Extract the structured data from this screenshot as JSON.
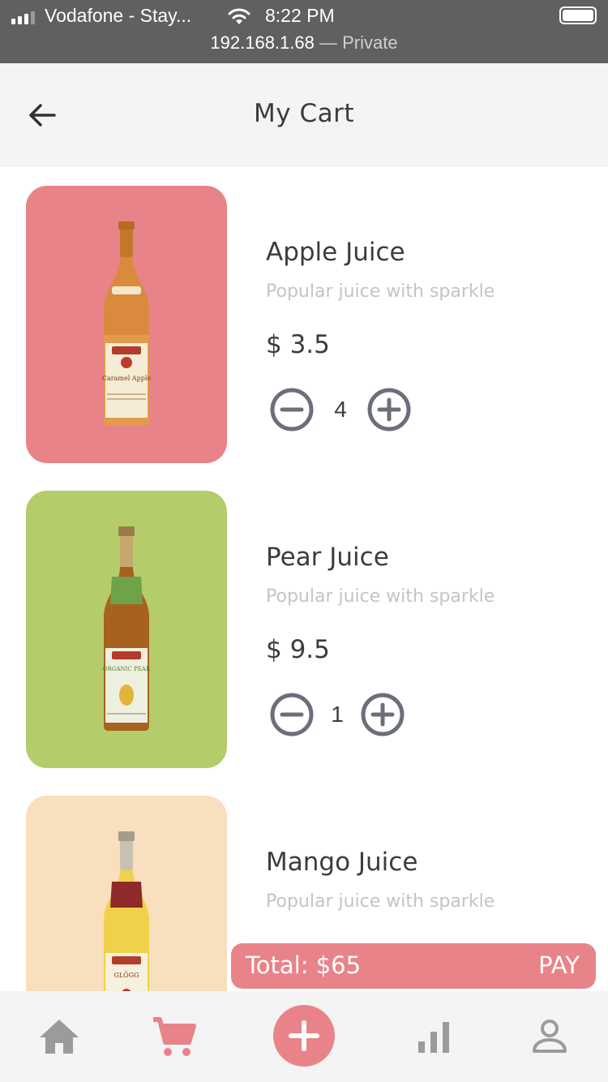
{
  "status_bar": {
    "carrier": "Vodafone - Stay...",
    "time": "8:22 PM",
    "url": "192.168.1.68",
    "url_suffix": " — Private"
  },
  "header": {
    "title": "My Cart",
    "back_icon": "arrow-left-icon"
  },
  "cart": {
    "items": [
      {
        "name": "Apple Juice",
        "description": "Popular juice with sparkle",
        "price": "$ 3.5",
        "quantity": "4",
        "bg_color": "#e9838a",
        "bottle_color": "#d8882e",
        "label_text": "Caramel Apple"
      },
      {
        "name": "Pear Juice",
        "description": "Popular juice with sparkle",
        "price": "$ 9.5",
        "quantity": "1",
        "bg_color": "#b5cc6a",
        "bottle_color": "#a8611f",
        "label_text": "ORGANIC PEAR"
      },
      {
        "name": "Mango Juice",
        "description": "Popular juice with sparkle",
        "bg_color": "#f8dfbd",
        "bottle_color": "#f0d24a",
        "label_text": "GLÖGG"
      }
    ]
  },
  "total_bar": {
    "total_text": "Total: $65",
    "pay_label": "PAY",
    "color": "#e9838a"
  },
  "bottom_nav": {
    "items": [
      "home-icon",
      "cart-icon",
      "add-icon",
      "stats-icon",
      "profile-icon"
    ],
    "active_color": "#e9838a",
    "inactive_color": "#9b9b9b"
  }
}
